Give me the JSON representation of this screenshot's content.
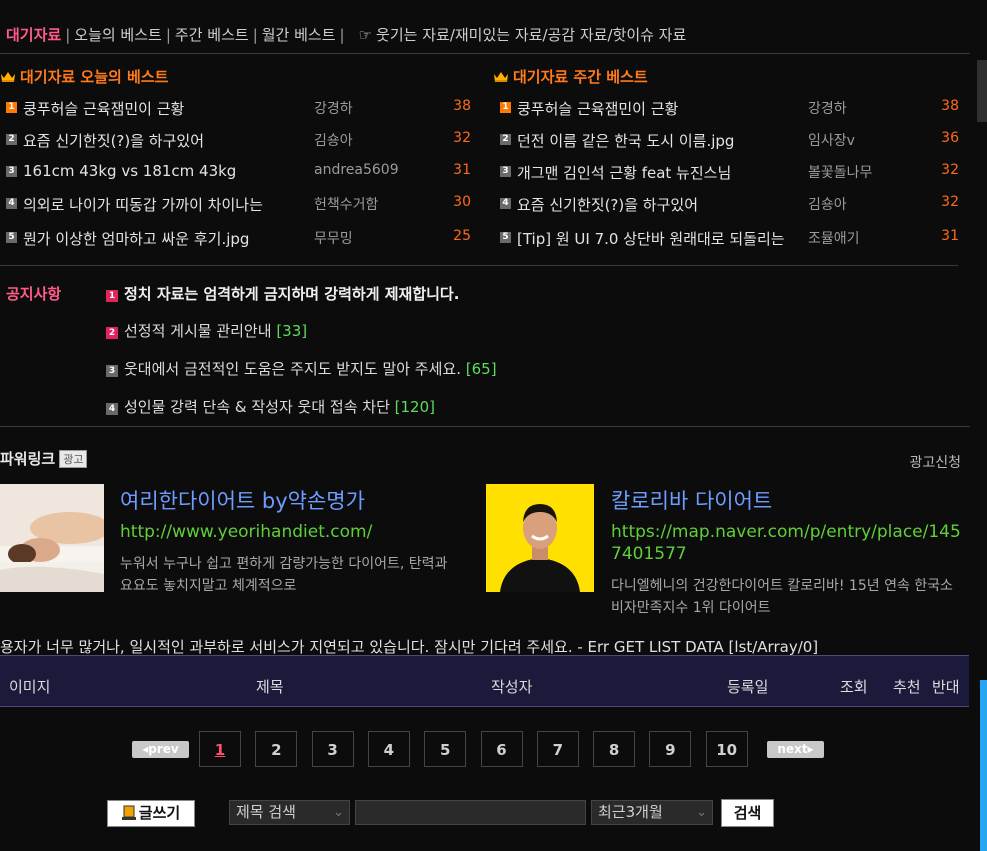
{
  "nav": {
    "current": "대기자료",
    "links": [
      "오늘의 베스트",
      "주간 베스트",
      "월간 베스트"
    ],
    "hand": "☞",
    "categories": "웃기는 자료/재미있는 자료/공감 자료/핫이슈 자료"
  },
  "today_best": {
    "title": "대기자료 오늘의 베스트",
    "items": [
      {
        "rank": "1",
        "title": "쿵푸허슬 근육잼민이 근황",
        "author": "강경하",
        "score": "38"
      },
      {
        "rank": "2",
        "title": "요즘 신기한짓(?)을 하구있어",
        "author": "김숑아",
        "score": "32"
      },
      {
        "rank": "3",
        "title": "161cm 43kg vs 181cm 43kg",
        "author": "andrea5609",
        "score": "31"
      },
      {
        "rank": "4",
        "title": "의외로 나이가 띠동갑 가까이 차이나는",
        "author": "헌책수거함",
        "score": "30"
      },
      {
        "rank": "5",
        "title": "뭔가 이상한 엄마하고 싸운 후기.jpg",
        "author": "무무밍",
        "score": "25"
      }
    ]
  },
  "weekly_best": {
    "title": "대기자료 주간 베스트",
    "items": [
      {
        "rank": "1",
        "title": "쿵푸허슬 근육잼민이 근황",
        "author": "강경하",
        "score": "38"
      },
      {
        "rank": "2",
        "title": "던전 이름 같은 한국 도시 이름.jpg",
        "author": "임사장v",
        "score": "36"
      },
      {
        "rank": "3",
        "title": "개그맨 김인석 근황 feat 뉴진스님",
        "author": "볼꽃돌나무",
        "score": "32"
      },
      {
        "rank": "4",
        "title": "요즘 신기한짓(?)을 하구있어",
        "author": "김숑아",
        "score": "32"
      },
      {
        "rank": "5",
        "title": "[Tip] 원 UI 7.0 상단바 원래대로 되돌리는",
        "author": "조뮬애기",
        "score": "31"
      }
    ]
  },
  "notices": {
    "label": "공지사항",
    "items": [
      {
        "rank": "1",
        "text": "정치 자료는 엄격하게 금지하며 강력하게 제재합니다.",
        "count": ""
      },
      {
        "rank": "2",
        "text": "선정적 게시물 관리안내",
        "count": "[33]"
      },
      {
        "rank": "3",
        "text": "웃대에서 금전적인 도움은 주지도 받지도 말아 주세요.",
        "count": "[65]"
      },
      {
        "rank": "4",
        "text": "성인물 강력 단속 & 작성자 웃대 접속 차단",
        "count": "[120]"
      }
    ]
  },
  "powerlink": {
    "title": "파워링크",
    "ad_tag": "광고",
    "apply": "광고신청",
    "ads": [
      {
        "title": "여리한다이어트 by약손명가",
        "url": "http://www.yeorihandiet.com/",
        "desc": "누워서 누구나 쉽고 편하게 감량가능한 다이어트, 탄력과요요도 놓치지말고 체계적으로"
      },
      {
        "title": "칼로리바 다이어트",
        "url": "https://map.naver.com/p/entry/place/1457401577",
        "desc": "다니엘헤니의 건강한다이어트 칼로리바! 15년 연속 한국소비자만족지수 1위 다이어트"
      }
    ]
  },
  "error_message": "용자가 너무 많거나, 일시적인 과부하로 서비스가 지연되고 있습니다. 잠시만 기다려 주세요. - Err GET LIST DATA [lst/Array/0]",
  "table_header": {
    "image": "이미지",
    "title": "제목",
    "author": "작성자",
    "date": "등록일",
    "views": "조회",
    "recommend": "추천",
    "oppose": "반대"
  },
  "pagination": {
    "prev": "prev",
    "next": "next",
    "pages": [
      "1",
      "2",
      "3",
      "4",
      "5",
      "6",
      "7",
      "8",
      "9",
      "10"
    ],
    "current": "1"
  },
  "bottom": {
    "write": "글쓰기",
    "search_type": "제목 검색",
    "search_value": "",
    "period": "최근3개월",
    "search_button": "검색"
  },
  "colors": {
    "accent_pink": "#ff5c8a",
    "orange": "#ff7a1a",
    "ad_title_blue": "#6f9cff",
    "ad_url_green": "#5fcf3a",
    "count_green": "#5fdc5f",
    "header_bg": "#1b1a3a"
  }
}
